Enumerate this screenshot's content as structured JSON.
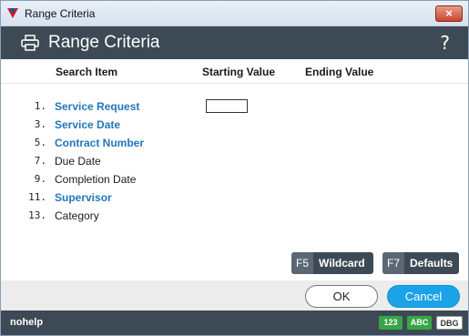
{
  "window": {
    "title": "Range Criteria",
    "close_label": "×"
  },
  "header": {
    "title": "Range Criteria",
    "help_label": "?"
  },
  "columns": {
    "search_item": "Search Item",
    "starting_value": "Starting Value",
    "ending_value": "Ending Value"
  },
  "rows": [
    {
      "num": "1.",
      "label": "Service Request"
    },
    {
      "num": "3.",
      "label": "Service Date"
    },
    {
      "num": "5.",
      "label": "Contract Number"
    },
    {
      "num": "7.",
      "label": "Due Date"
    },
    {
      "num": "9.",
      "label": "Completion Date"
    },
    {
      "num": "11.",
      "label": "Supervisor"
    },
    {
      "num": "13.",
      "label": "Category"
    }
  ],
  "starting_value_input": {
    "value": ""
  },
  "function_keys": {
    "wildcard": {
      "key": "F5",
      "label": "Wildcard"
    },
    "defaults": {
      "key": "F7",
      "label": "Defaults"
    }
  },
  "buttons": {
    "ok": "OK",
    "cancel": "Cancel"
  },
  "status": {
    "text": "nohelp",
    "badges": [
      "123",
      "ABC",
      "DBG"
    ]
  },
  "colors": {
    "header_bg": "#3d4a55",
    "link": "#2277b8",
    "cancel_bg": "#1aa3e8",
    "badge_green": "#3aa44a"
  }
}
